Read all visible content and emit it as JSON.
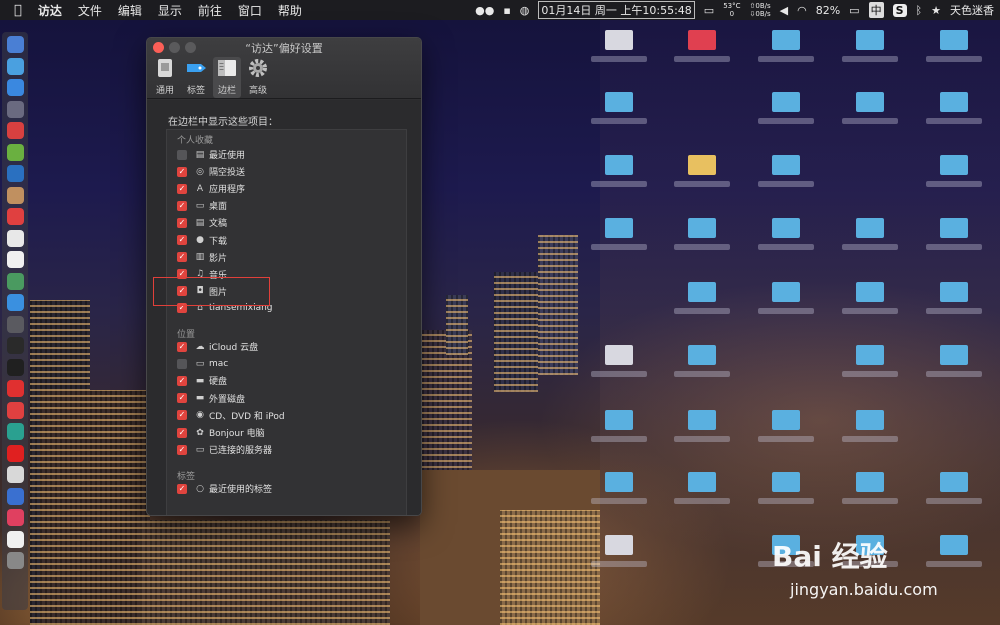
{
  "menubar": {
    "app_name": "访达",
    "menus": [
      "文件",
      "编辑",
      "显示",
      "前往",
      "窗口",
      "帮助"
    ],
    "temperature": "53°C",
    "temperature_sub": "0",
    "net_up": "0B/s",
    "net_down": "0B/s",
    "datetime": "01月14日 周一 上午10:55:48",
    "battery": "82%",
    "input_method": "中",
    "user": "天色迷香"
  },
  "window": {
    "title": "“访达”偏好设置",
    "toolbar": [
      {
        "label": "通用",
        "icon": "general-icon"
      },
      {
        "label": "标签",
        "icon": "tag-icon"
      },
      {
        "label": "边栏",
        "icon": "sidebar-icon",
        "active": true
      },
      {
        "label": "高级",
        "icon": "gear-icon"
      }
    ],
    "heading": "在边栏中显示这些项目：",
    "sections": {
      "favorites": "个人收藏",
      "locations": "位置",
      "tags": "标签"
    },
    "favorites": [
      {
        "label": "最近使用",
        "checked": false,
        "icon": "recents-icon"
      },
      {
        "label": "隔空投送",
        "checked": true,
        "icon": "airdrop-icon"
      },
      {
        "label": "应用程序",
        "checked": true,
        "icon": "applications-icon"
      },
      {
        "label": "桌面",
        "checked": true,
        "icon": "desktop-icon"
      },
      {
        "label": "文稿",
        "checked": true,
        "icon": "documents-icon"
      },
      {
        "label": "下载",
        "checked": true,
        "icon": "downloads-icon"
      },
      {
        "label": "影片",
        "checked": true,
        "icon": "movies-icon"
      },
      {
        "label": "音乐",
        "checked": true,
        "icon": "music-icon"
      },
      {
        "label": "图片",
        "checked": true,
        "icon": "pictures-icon"
      },
      {
        "label": "tiansemixiang",
        "checked": true,
        "icon": "home-icon"
      }
    ],
    "locations": [
      {
        "label": "iCloud 云盘",
        "checked": true,
        "icon": "icloud-icon"
      },
      {
        "label": "mac",
        "checked": false,
        "icon": "computer-icon"
      },
      {
        "label": "硬盘",
        "checked": true,
        "icon": "harddisk-icon"
      },
      {
        "label": "外置磁盘",
        "checked": true,
        "icon": "external-disk-icon"
      },
      {
        "label": "CD、DVD 和 iPod",
        "checked": true,
        "icon": "disc-icon"
      },
      {
        "label": "Bonjour 电脑",
        "checked": true,
        "icon": "bonjour-icon"
      },
      {
        "label": "已连接的服务器",
        "checked": true,
        "icon": "server-icon"
      }
    ],
    "tags": [
      {
        "label": "最近使用的标签",
        "checked": true,
        "icon": "tag-circle-icon"
      }
    ]
  },
  "colors": {
    "checkbox_on": "#e0443e",
    "highlight": "#e0403a",
    "window_bg": "#2b2b2d"
  },
  "watermark": {
    "brand": "Bai 经验",
    "url": "jingyan.baidu.com"
  }
}
